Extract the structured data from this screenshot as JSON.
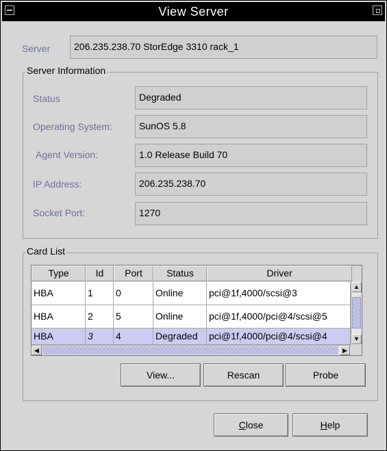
{
  "window": {
    "title": "View Server"
  },
  "server": {
    "label": "Server",
    "value": "206.235.238.70 StorEdge 3310 rack_1"
  },
  "server_info": {
    "group_title": "Server Information",
    "status_label": "Status",
    "status_value": "Degraded",
    "os_label": "Operating System:",
    "os_value": "SunOS 5.8",
    "agent_label": "Agent Version:",
    "agent_value": "1.0 Release Build 70",
    "ip_label": "IP Address:",
    "ip_value": "206.235.238.70",
    "port_label": "Socket Port:",
    "port_value": "1270"
  },
  "card_list": {
    "group_title": "Card List",
    "columns": [
      "Type",
      "Id",
      "Port",
      "Status",
      "Driver"
    ],
    "rows": [
      {
        "type": "HBA",
        "id": "1",
        "port": "0",
        "status": "Online",
        "driver": "pci@1f,4000/scsi@3"
      },
      {
        "type": "HBA",
        "id": "2",
        "port": "5",
        "status": "Online",
        "driver": "pci@1f,4000/pci@4/scsi@5"
      },
      {
        "type": "HBA",
        "id": "3",
        "port": "4",
        "status": "Degraded",
        "driver": "pci@1f,4000/pci@4/scsi@4"
      }
    ],
    "selected_row": 3
  },
  "buttons": {
    "view": "View...",
    "rescan": "Rescan",
    "probe": "Probe",
    "close_mnemonic": "C",
    "close_rest": "lose",
    "help_mnemonic": "H",
    "help_rest": "elp"
  },
  "icons": {
    "window_menu": "window-menu-icon",
    "maximize": "maximize-icon",
    "scroll_up": "arrow-up-icon",
    "scroll_down": "arrow-down-icon",
    "scroll_left": "arrow-left-icon",
    "scroll_right": "arrow-right-icon"
  }
}
